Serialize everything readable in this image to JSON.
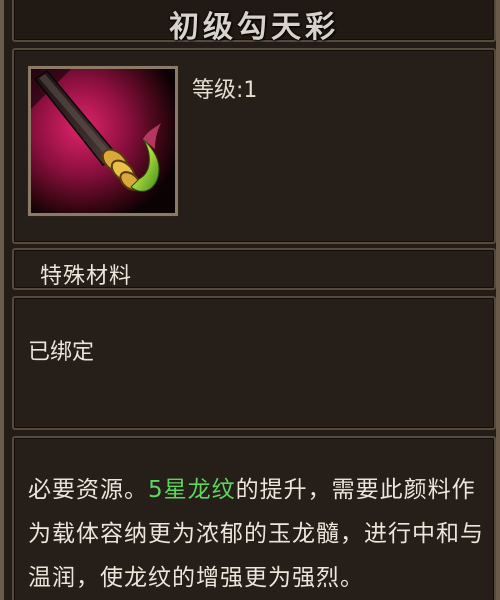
{
  "item": {
    "name": "初级勾天彩",
    "level_text": "等级:1",
    "type": "特殊材料",
    "bind_status": "已绑定",
    "icon": "paint-brush-icon",
    "description": {
      "prefix": "必要资源。",
      "highlight": "5星龙纹",
      "highlight_color": "#5cd65c",
      "body": "的提升，需要此颜料作为载体容纳更为浓郁的玉龙髓，进行中和与温润，使龙纹的增强更为强烈。"
    }
  },
  "colors": {
    "text": "#ebe5da",
    "panel_border": "#574a3d",
    "background": "#231c17"
  }
}
